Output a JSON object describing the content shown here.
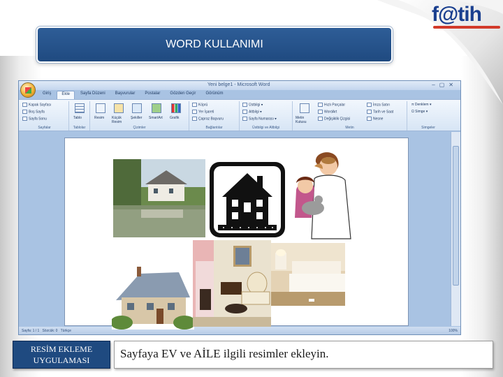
{
  "slide": {
    "title": "WORD KULLANIMI",
    "logo_text": "f@tih",
    "label_line1": "RESİM EKLEME",
    "label_line2": "UYGULAMASI",
    "instruction": "Sayfaya EV ve AİLE ilgili resimler ekleyin."
  },
  "word": {
    "window_title": "Yeni belge1 - Microsoft Word",
    "tabs": [
      "Giriş",
      "Ekle",
      "Sayfa Düzeni",
      "Başvurular",
      "Postalar",
      "Gözden Geçir",
      "Görünüm"
    ],
    "active_tab_index": 1,
    "groups": {
      "pages": {
        "label": "Sayfalar",
        "items": [
          "Kapak Sayfası",
          "Boş Sayfa",
          "Sayfa Sonu"
        ]
      },
      "tables": {
        "label": "Tablolar",
        "table_button": "Tablo"
      },
      "illustrations": {
        "label": "Çizimler",
        "buttons": [
          "Resim",
          "Küçük Resim",
          "Şekiller",
          "SmartArt",
          "Grafik"
        ]
      },
      "links": {
        "label": "Bağlantılar",
        "items": [
          "Köprü",
          "Yer İşareti",
          "Çapraz Başvuru"
        ]
      },
      "header_footer": {
        "label": "Üstbilgi ve Altbilgi",
        "items": [
          "Üstbilgi",
          "Altbilgi",
          "Sayfa Numarası"
        ]
      },
      "text": {
        "label": "Metin",
        "big_button": "Metin Kutusu",
        "items": [
          "Hızlı Parçalar",
          "WordArt",
          "Değişiklik Çizgisi",
          "İmza Satırı",
          "Tarih ve Saat",
          "Nesne"
        ]
      },
      "symbols": {
        "label": "Simgeler",
        "items": [
          "Denklem",
          "Simge"
        ]
      }
    },
    "status": {
      "page": "Sayfa: 1 / 1",
      "words": "Sözcük: 0",
      "language": "Türkçe",
      "zoom": "100%"
    },
    "pictures": [
      "countryside-house-photo",
      "house-silhouette-clipart",
      "family-with-pet-clipart",
      "cottage-clipart",
      "living-room-fireplace-clipart",
      "bedroom-photo"
    ]
  }
}
